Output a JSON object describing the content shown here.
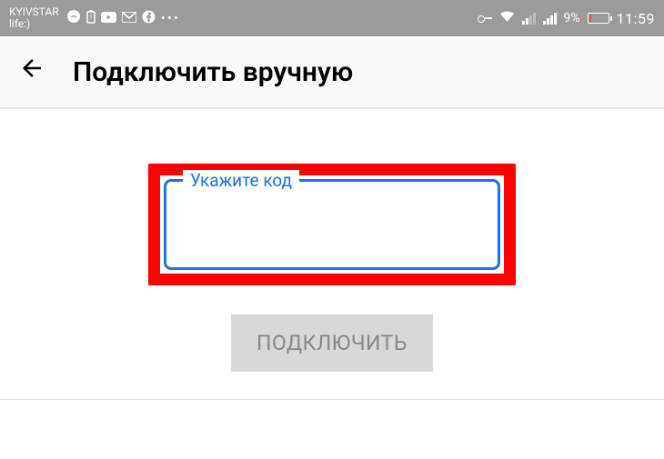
{
  "status_bar": {
    "carrier_line1": "KYIVSTAR",
    "carrier_line2": "life:)",
    "battery_percent": "9%",
    "clock": "11:59",
    "dots": "•••"
  },
  "app_bar": {
    "title": "Подключить вручную"
  },
  "form": {
    "input_label": "Укажите код",
    "input_value": "",
    "connect_button": "ПОДКЛЮЧИТЬ"
  },
  "colors": {
    "accent": "#1a73e8",
    "highlight": "#ff0000",
    "status_bg": "#9b9b9b",
    "button_disabled_bg": "#d8d8d8",
    "button_disabled_text": "#888"
  }
}
